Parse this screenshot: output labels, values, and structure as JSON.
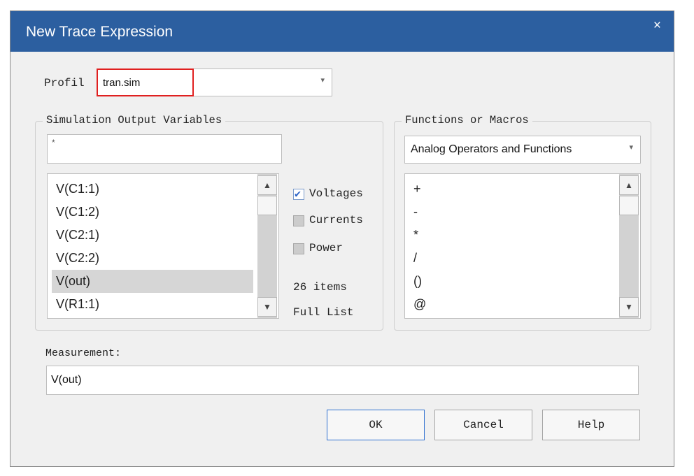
{
  "window": {
    "title": "New Trace Expression",
    "close_glyph": "×"
  },
  "profile": {
    "label": "Profil",
    "value": "tran.sim",
    "arrow": "▾"
  },
  "simulation": {
    "legend": "Simulation Output Variables",
    "filter_value": "*",
    "items": [
      "V(C1:1)",
      "V(C1:2)",
      "V(C2:1)",
      "V(C2:2)",
      "V(out)",
      "V(R1:1)"
    ],
    "selected_item": "V(out)",
    "options": [
      {
        "label": "Voltages",
        "checked": true
      },
      {
        "label": "Currents",
        "checked": false
      },
      {
        "label": "Power",
        "checked": false
      }
    ],
    "count": "26 items",
    "list_mode": "Full List"
  },
  "functions": {
    "legend": "Functions or Macros",
    "category": "Analog Operators and Functions",
    "arrow": "▾",
    "items": [
      "+",
      "-",
      "*",
      "/",
      "()",
      "@"
    ]
  },
  "measurement": {
    "label": "Measurement:",
    "value": "V(out)"
  },
  "buttons": {
    "ok": "OK",
    "cancel": "Cancel",
    "help": "Help"
  },
  "scroll_glyphs": {
    "up": "▲",
    "down": "▼"
  },
  "colors": {
    "titlebar": "#2c5fa0",
    "highlight_border": "#e02020",
    "selection": "#d6d6d6",
    "default_button_border": "#2e6fd0"
  }
}
